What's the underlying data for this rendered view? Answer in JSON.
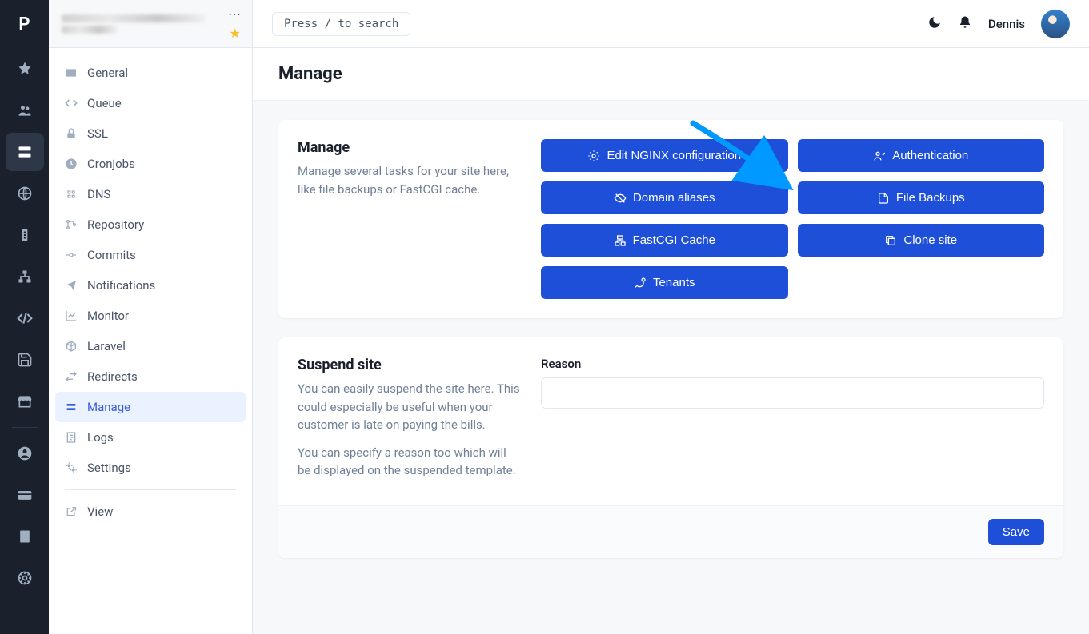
{
  "brand": {
    "logo": "P"
  },
  "topbar": {
    "search_hint": "Press / to search",
    "username": "Dennis"
  },
  "sidebar": {
    "items": [
      {
        "label": "General"
      },
      {
        "label": "Queue"
      },
      {
        "label": "SSL"
      },
      {
        "label": "Cronjobs"
      },
      {
        "label": "DNS"
      },
      {
        "label": "Repository"
      },
      {
        "label": "Commits"
      },
      {
        "label": "Notifications"
      },
      {
        "label": "Monitor"
      },
      {
        "label": "Laravel"
      },
      {
        "label": "Redirects"
      },
      {
        "label": "Manage"
      },
      {
        "label": "Logs"
      },
      {
        "label": "Settings"
      },
      {
        "label": "View"
      }
    ]
  },
  "page": {
    "title": "Manage"
  },
  "manage_card": {
    "title": "Manage",
    "description": "Manage several tasks for your site here, like file backups or FastCGI cache.",
    "buttons": {
      "nginx": "Edit NGINX configuration",
      "auth": "Authentication",
      "domain": "Domain aliases",
      "backups": "File Backups",
      "fastcgi": "FastCGI Cache",
      "clone": "Clone site",
      "tenants": "Tenants"
    }
  },
  "suspend_card": {
    "title": "Suspend site",
    "desc1": "You can easily suspend the site here. This could especially be useful when your customer is late on paying the bills.",
    "desc2": "You can specify a reason too which will be displayed on the suspended template.",
    "reason_label": "Reason",
    "reason_value": "",
    "save_label": "Save"
  }
}
